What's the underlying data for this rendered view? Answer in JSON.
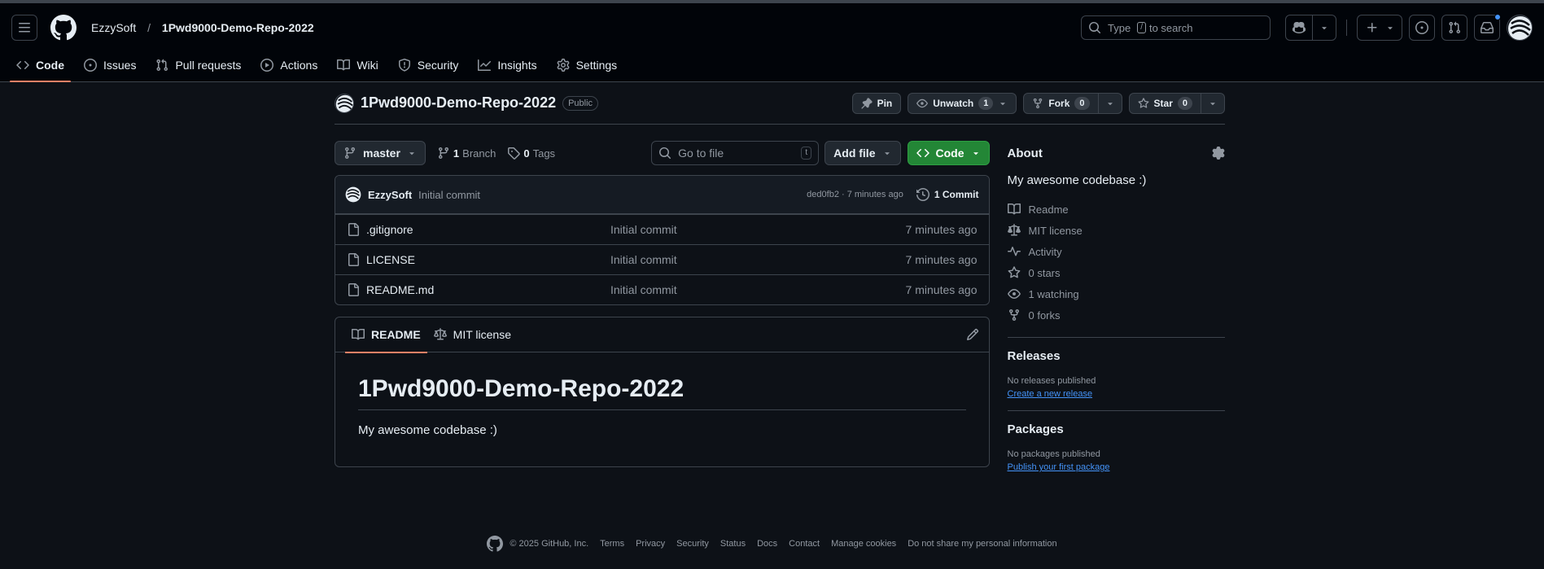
{
  "header": {
    "owner": "EzzySoft",
    "separator": "/",
    "repo": "1Pwd9000-Demo-Repo-2022",
    "search": {
      "prefix": "Type",
      "key": "/",
      "suffix": "to search"
    }
  },
  "tabs": [
    {
      "label": "Code",
      "icon": "code-icon",
      "selected": true
    },
    {
      "label": "Issues",
      "icon": "issue-icon"
    },
    {
      "label": "Pull requests",
      "icon": "pull-request-icon"
    },
    {
      "label": "Actions",
      "icon": "play-icon"
    },
    {
      "label": "Wiki",
      "icon": "book-icon"
    },
    {
      "label": "Security",
      "icon": "shield-icon"
    },
    {
      "label": "Insights",
      "icon": "graph-icon"
    },
    {
      "label": "Settings",
      "icon": "gear-icon"
    }
  ],
  "repo": {
    "name": "1Pwd9000-Demo-Repo-2022",
    "visibility": "Public",
    "pin_label": "Pin",
    "unwatch_label": "Unwatch",
    "unwatch_count": "1",
    "fork_label": "Fork",
    "fork_count": "0",
    "star_label": "Star",
    "star_count": "0"
  },
  "toolbar": {
    "branch": "master",
    "branches_count": "1",
    "branches_label": "Branch",
    "tags_count": "0",
    "tags_label": "Tags",
    "goto_placeholder": "Go to file",
    "goto_key": "t",
    "add_file": "Add file",
    "code": "Code"
  },
  "commit": {
    "author": "EzzySoft",
    "message": "Initial commit",
    "meta": "ded0fb2 · 7 minutes ago",
    "count_label": "1 Commit"
  },
  "files": [
    {
      "name": ".gitignore",
      "commit": "Initial commit",
      "time": "7 minutes ago"
    },
    {
      "name": "LICENSE",
      "commit": "Initial commit",
      "time": "7 minutes ago"
    },
    {
      "name": "README.md",
      "commit": "Initial commit",
      "time": "7 minutes ago"
    }
  ],
  "readme": {
    "tab_readme": "README",
    "tab_license": "MIT license",
    "heading": "1Pwd9000-Demo-Repo-2022",
    "body": "My awesome codebase :)"
  },
  "about": {
    "title": "About",
    "description": "My awesome codebase :)",
    "items": [
      {
        "icon": "book-icon",
        "label": "Readme"
      },
      {
        "icon": "law-icon",
        "label": "MIT license"
      },
      {
        "icon": "pulse-icon",
        "label": "Activity"
      },
      {
        "icon": "star-icon",
        "label": "0 stars"
      },
      {
        "icon": "eye-icon",
        "label": "1 watching"
      },
      {
        "icon": "fork-icon",
        "label": "0 forks"
      }
    ]
  },
  "releases": {
    "title": "Releases",
    "note": "No releases published",
    "link": "Create a new release"
  },
  "packages": {
    "title": "Packages",
    "note": "No packages published",
    "link": "Publish your first package"
  },
  "footer": {
    "copyright": "© 2025 GitHub, Inc.",
    "links": [
      "Terms",
      "Privacy",
      "Security",
      "Status",
      "Docs",
      "Contact",
      "Manage cookies",
      "Do not share my personal information"
    ]
  },
  "colors": {
    "background": "#0d1117",
    "header_bg": "#010409",
    "accent_tab": "#f78166",
    "code_button": "#238636",
    "link": "#4493f8"
  }
}
